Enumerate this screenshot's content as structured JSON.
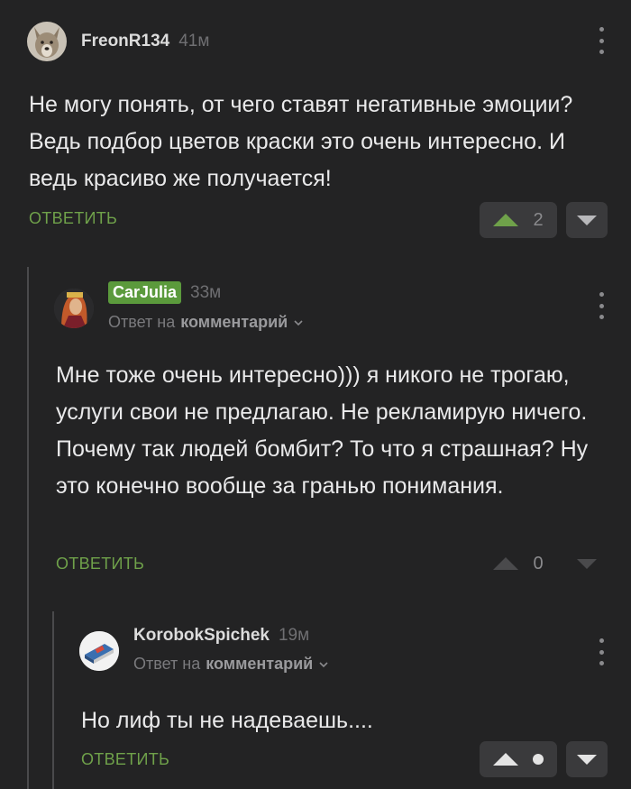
{
  "comments": [
    {
      "author": "FreonR134",
      "time": "41м",
      "text": "Не могу понять, от чего ставят негативные эмоции? Ведь подбор цветов краски это очень интересно. И ведь красиво же получается!",
      "reply_label": "ОТВЕТИТЬ",
      "score": "2",
      "avatar": "wolf-avatar"
    },
    {
      "author": "CarJulia",
      "time": "33м",
      "reply_prefix": "Ответ на",
      "reply_target": "комментарий",
      "text": "Мне тоже очень интересно))) я никого не трогаю, услуги свои не предлагаю. Не рекламирую ничего. Почему так людей бомбит? То что я страшная? Ну это конечно вообще за гранью понимания.",
      "reply_label": "ОТВЕТИТЬ",
      "score": "0",
      "avatar": "woman-portrait-avatar"
    },
    {
      "author": "KorobokSpichek",
      "time": "19м",
      "reply_prefix": "Ответ на",
      "reply_target": "комментарий",
      "text": "Но лиф ты не надеваешь....",
      "reply_label": "ОТВЕТИТЬ",
      "avatar": "matchbox-avatar"
    }
  ],
  "colors": {
    "background": "#232324",
    "accent_green": "#6fa14a",
    "badge_green": "#5b9a3c",
    "button_bg": "#3a3a3c"
  }
}
